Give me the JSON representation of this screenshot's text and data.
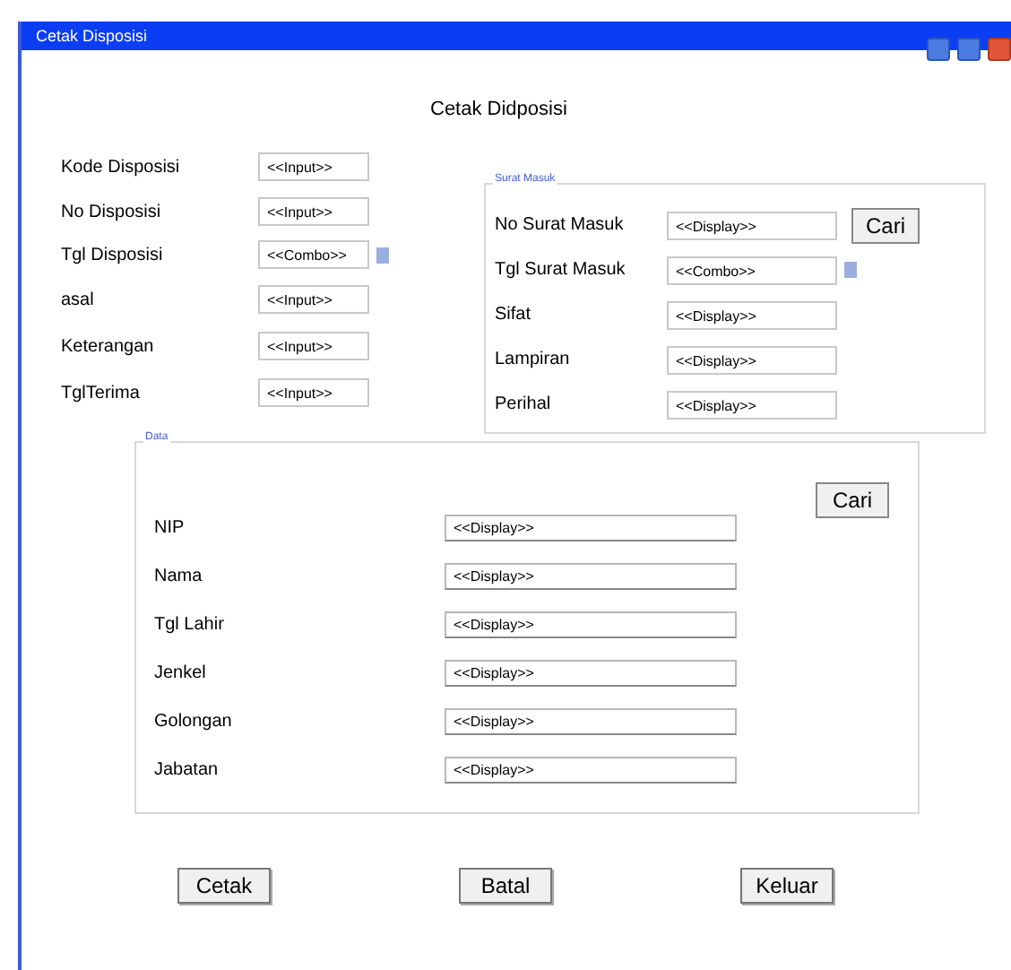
{
  "window": {
    "title": "Cetak Disposisi"
  },
  "heading": "Cetak Didposisi",
  "disposisi_fields": [
    {
      "label": "Kode Disposisi",
      "value": "<<Input>>",
      "kind": "input"
    },
    {
      "label": "No Disposisi",
      "value": "<<Input>>",
      "kind": "input"
    },
    {
      "label": "Tgl Disposisi",
      "value": "<<Combo>>",
      "kind": "combo"
    },
    {
      "label": "asal",
      "value": "<<Input>>",
      "kind": "input"
    },
    {
      "label": "Keterangan",
      "value": "<<Input>>",
      "kind": "input"
    },
    {
      "label": "TglTerima",
      "value": "<<Input>>",
      "kind": "input"
    }
  ],
  "surat_masuk": {
    "legend": "Surat Masuk",
    "search_button": "Cari",
    "fields": [
      {
        "label": "No Surat Masuk",
        "value": "<<Display>>",
        "kind": "input"
      },
      {
        "label": "Tgl Surat Masuk",
        "value": "<<Combo>>",
        "kind": "combo"
      },
      {
        "label": "Sifat",
        "value": "<<Display>>",
        "kind": "input"
      },
      {
        "label": "Lampiran",
        "value": "<<Display>>",
        "kind": "input"
      },
      {
        "label": "Perihal",
        "value": "<<Display>>",
        "kind": "input"
      }
    ]
  },
  "pegawai": {
    "legend": "Data",
    "search_button": "Cari",
    "fields": [
      {
        "label": "NIP",
        "value": "<<Display>>"
      },
      {
        "label": "Nama",
        "value": "<<Display>>"
      },
      {
        "label": "Tgl Lahir",
        "value": "<<Display>>"
      },
      {
        "label": "Jenkel",
        "value": "<<Display>>"
      },
      {
        "label": "Golongan",
        "value": "<<Display>>"
      },
      {
        "label": "Jabatan",
        "value": "<<Display>>"
      }
    ]
  },
  "buttons": [
    "Cetak",
    "Batal",
    "Keluar"
  ]
}
